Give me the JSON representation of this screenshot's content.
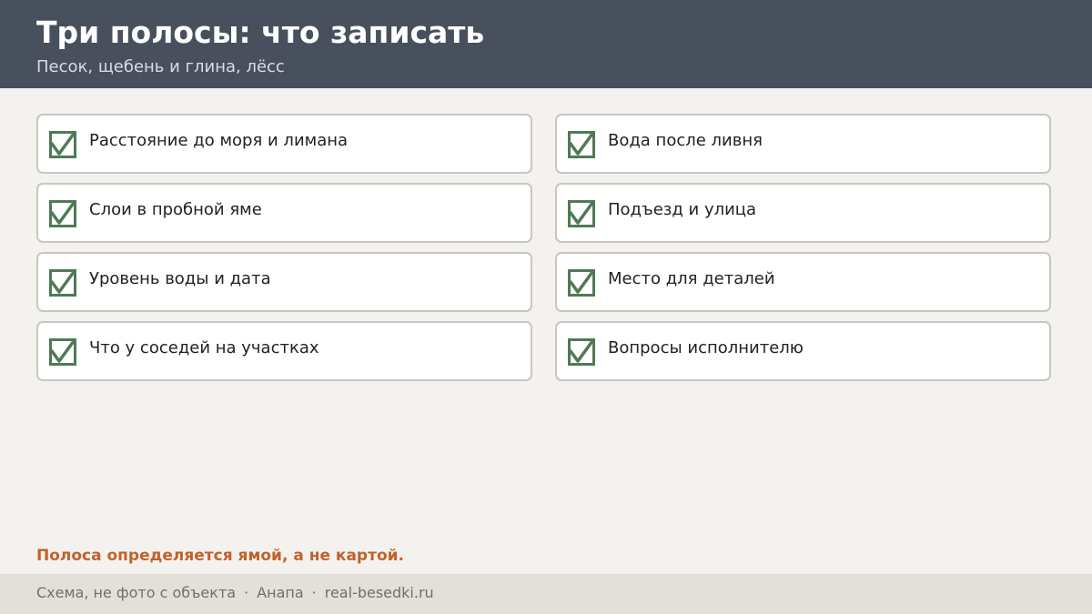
{
  "header": {
    "title": "Три полосы: что записать",
    "subtitle": "Песок, щебень и глина, лёсс"
  },
  "checklist": [
    {
      "label": "Расстояние до моря и лимана",
      "checked": true
    },
    {
      "label": "Вода после ливня",
      "checked": true
    },
    {
      "label": "Слои в пробной яме",
      "checked": true
    },
    {
      "label": "Подъезд и улица",
      "checked": true
    },
    {
      "label": "Уровень воды и дата",
      "checked": true
    },
    {
      "label": "Место для деталей",
      "checked": true
    },
    {
      "label": "Что у соседей на участках",
      "checked": true
    },
    {
      "label": "Вопросы исполнителю",
      "checked": true
    }
  ],
  "note": "Полоса определяется ямой, а не картой.",
  "footer": {
    "disclaimer": "Схема, не фото с объекта",
    "separator": "·",
    "city": "Анапа",
    "site": "real-besedki.ru"
  },
  "colors": {
    "header_bg": "#47505c",
    "check_green": "#4f7a55",
    "accent_orange": "#c0622b",
    "page_bg": "#f4f2ee",
    "footer_bg": "#e3e0d9"
  },
  "icons": {
    "checkbox": "checked-checkbox-icon"
  }
}
